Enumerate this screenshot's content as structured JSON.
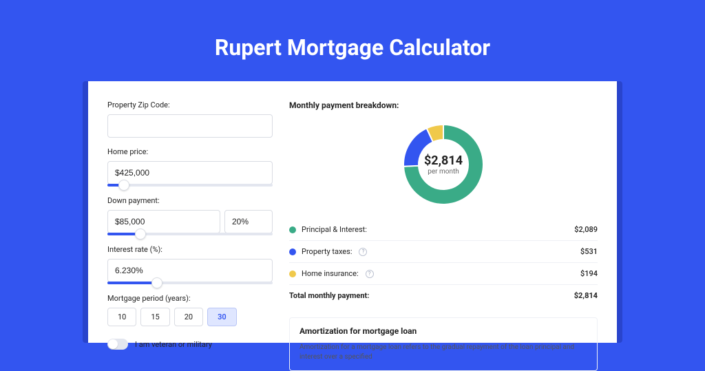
{
  "title": "Rupert Mortgage Calculator",
  "form": {
    "zip_label": "Property Zip Code:",
    "zip_value": "",
    "home_price_label": "Home price:",
    "home_price_value": "$425,000",
    "home_price_slider_pct": 10,
    "down_payment_label": "Down payment:",
    "down_payment_value": "$85,000",
    "down_payment_pct_value": "20%",
    "down_payment_slider_pct": 20,
    "interest_label": "Interest rate (%):",
    "interest_value": "6.230%",
    "interest_slider_pct": 30,
    "period_label": "Mortgage period (years):",
    "period_options": [
      "10",
      "15",
      "20",
      "30"
    ],
    "period_selected": "30",
    "veteran_label": "I am veteran or military",
    "veteran_on": false
  },
  "breakdown": {
    "title": "Monthly payment breakdown:",
    "center_amount": "$2,814",
    "center_sub": "per month",
    "items": [
      {
        "label": "Principal & Interest:",
        "amount": "$2,089",
        "value": 2089,
        "color": "#3aab87",
        "info": false
      },
      {
        "label": "Property taxes:",
        "amount": "$531",
        "value": 531,
        "color": "#3355f0",
        "info": true
      },
      {
        "label": "Home insurance:",
        "amount": "$194",
        "value": 194,
        "color": "#f0c94b",
        "info": true
      }
    ],
    "total_label": "Total monthly payment:",
    "total_amount": "$2,814"
  },
  "amortization": {
    "title": "Amortization for mortgage loan",
    "text": "Amortization for a mortgage loan refers to the gradual repayment of the loan principal and interest over a specified"
  },
  "chart_data": {
    "type": "pie",
    "title": "Monthly payment breakdown:",
    "series": [
      {
        "name": "Principal & Interest",
        "value": 2089,
        "color": "#3aab87"
      },
      {
        "name": "Property taxes",
        "value": 531,
        "color": "#3355f0"
      },
      {
        "name": "Home insurance",
        "value": 194,
        "color": "#f0c94b"
      }
    ],
    "total": 2814,
    "center_label": "$2,814 per month"
  }
}
